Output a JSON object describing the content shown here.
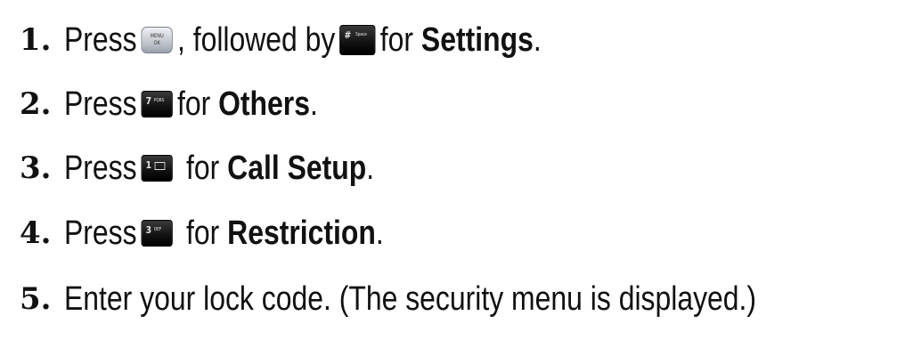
{
  "steps": [
    {
      "number": "1.",
      "pre": "Press",
      "mid": ", followed by",
      "post": "for",
      "bold": "Settings",
      "end": ".",
      "key1": {
        "icon": "menu-ok-key-icon",
        "line1": "MENU",
        "line2": "OK"
      },
      "key2": {
        "icon": "pound-key-icon",
        "main": "#",
        "sub": "Space"
      }
    },
    {
      "number": "2.",
      "pre": "Press",
      "post": "for",
      "bold": "Others",
      "end": ".",
      "key": {
        "icon": "seven-key-icon",
        "main": "7",
        "sub": "PQRS"
      }
    },
    {
      "number": "3.",
      "pre": "Press",
      "post": "for",
      "bold": "Call Setup",
      "end": ".",
      "key": {
        "icon": "one-key-icon",
        "main": "1",
        "sub": "voicemail"
      }
    },
    {
      "number": "4.",
      "pre": "Press",
      "post": "for",
      "bold": "Restriction",
      "end": ".",
      "key": {
        "icon": "three-key-icon",
        "main": "3",
        "sub": "DEF"
      }
    },
    {
      "number": "5.",
      "text": "Enter your lock code. (The security menu is displayed.)"
    }
  ]
}
